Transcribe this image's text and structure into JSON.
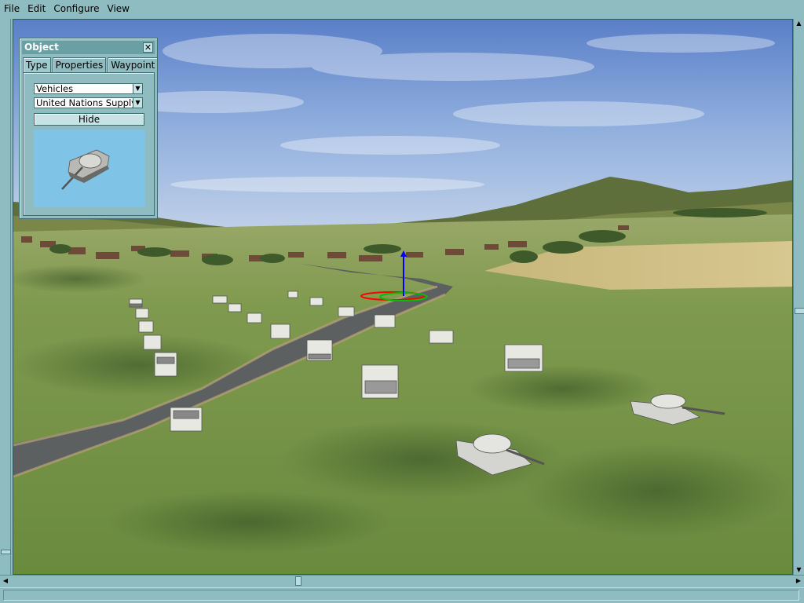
{
  "menubar": {
    "items": [
      "File",
      "Edit",
      "Configure",
      "View"
    ]
  },
  "object_panel": {
    "title": "Object",
    "tabs": [
      "Type",
      "Properties",
      "Waypoint"
    ],
    "active_tab": "Type",
    "category_value": "Vehicles",
    "faction_value": "United Nations Supply",
    "hide_label": "Hide",
    "preview_icon": "tank-icon"
  },
  "viewport": {
    "scene": "3d-terrain-view",
    "gizmo_colors": {
      "x": "#ff0000",
      "y": "#00c000",
      "z": "#0000ff"
    }
  },
  "colors": {
    "chrome": "#8fbcc0",
    "title_bar": "#6a9fa3",
    "preview_bg": "#7fc3e6"
  }
}
